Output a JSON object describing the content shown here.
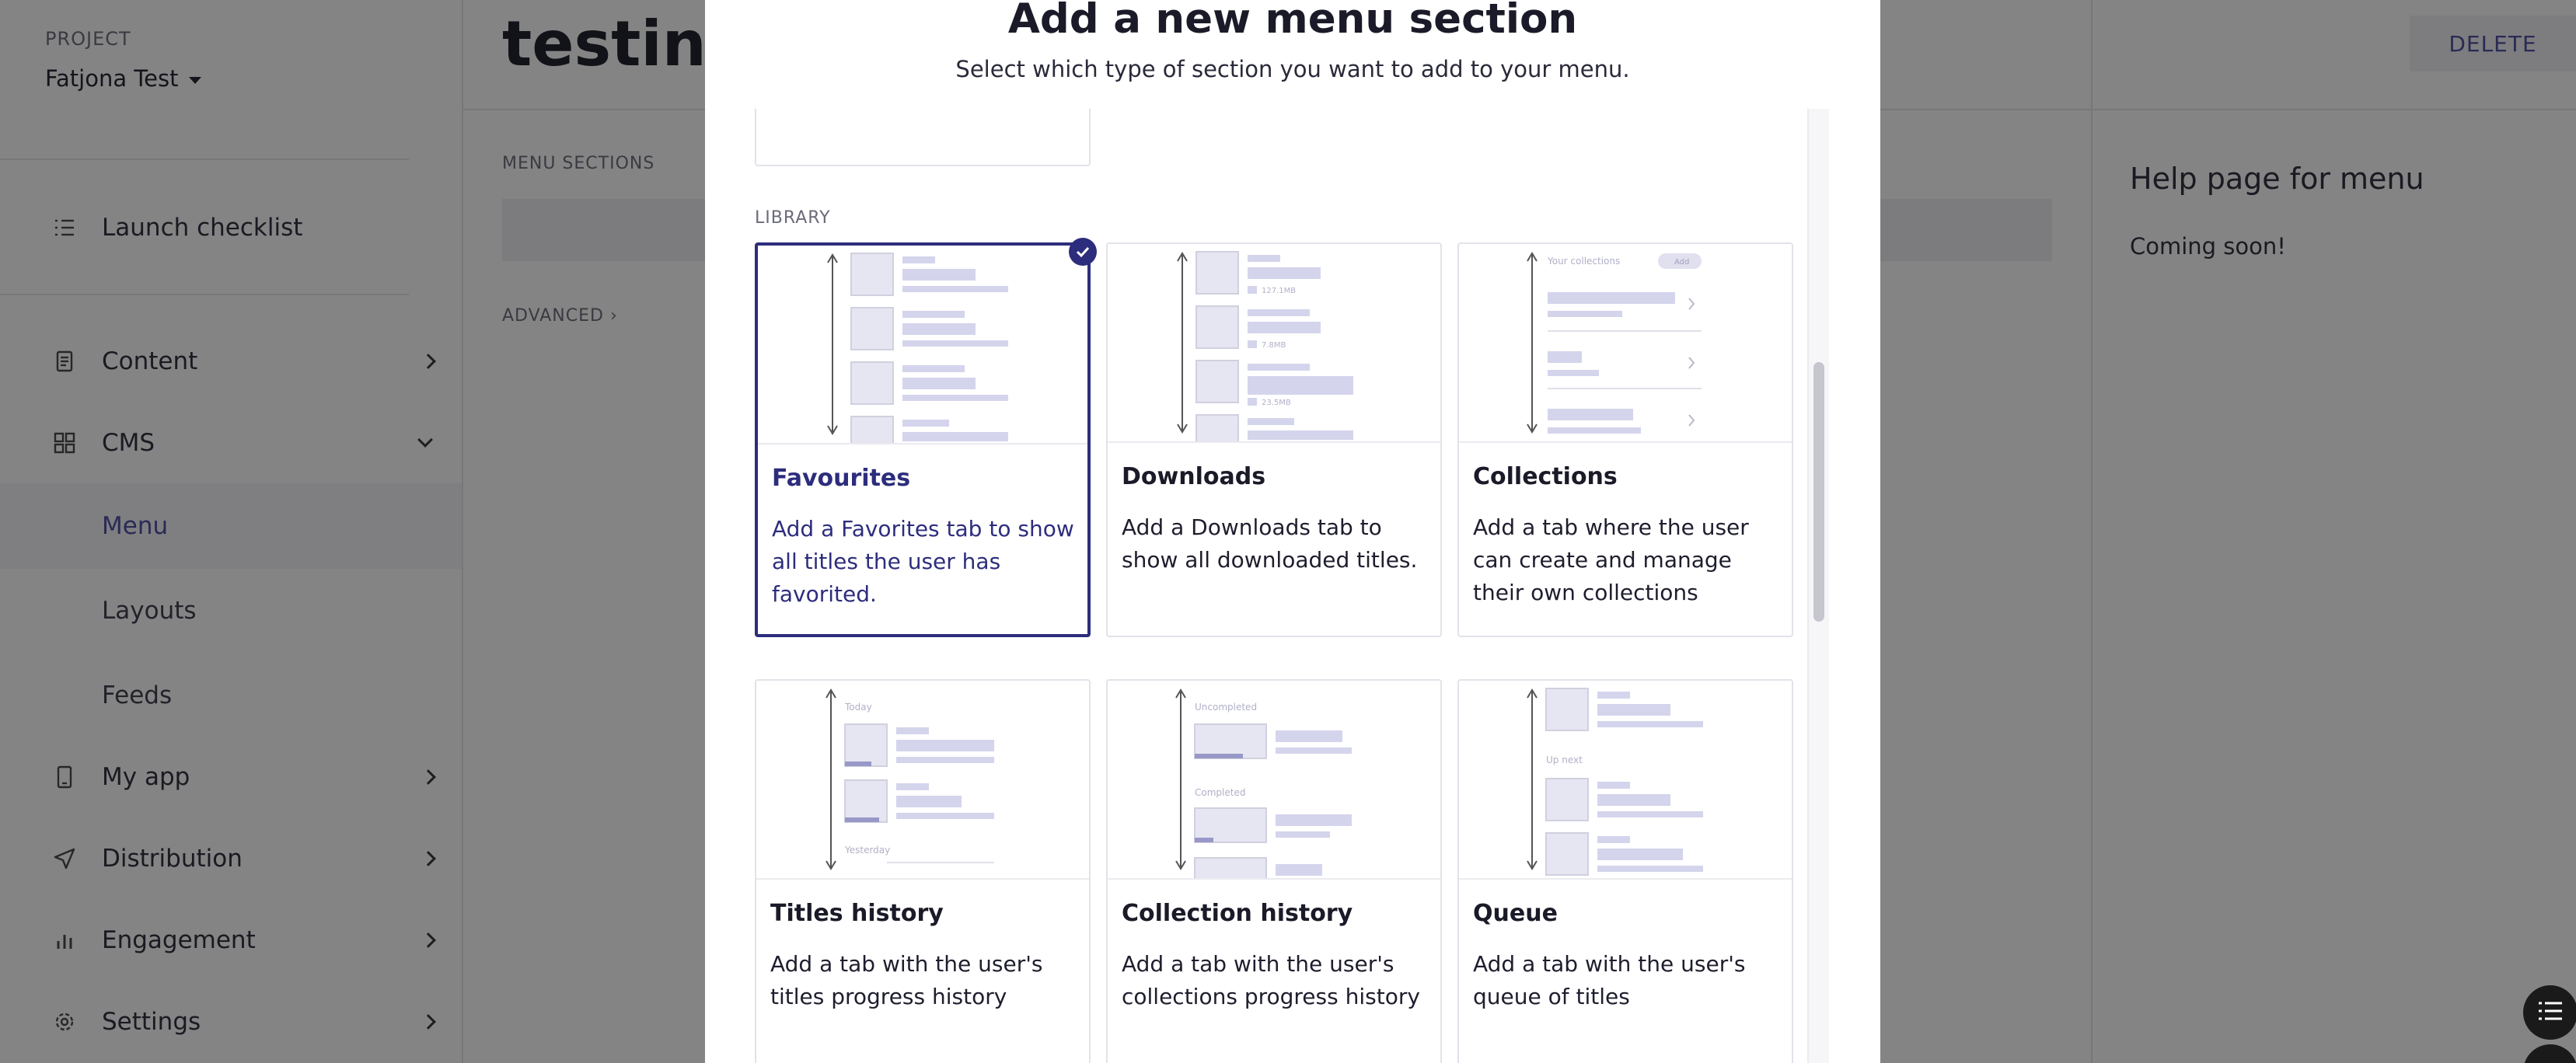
{
  "sidebar": {
    "project_label": "PROJECT",
    "project_name": "Fatjona Test",
    "items": [
      {
        "label": "Launch checklist",
        "icon": "checklist-icon"
      },
      {
        "label": "Content",
        "icon": "document-icon"
      },
      {
        "label": "CMS",
        "icon": "grid-icon"
      },
      {
        "label": "Menu"
      },
      {
        "label": "Layouts"
      },
      {
        "label": "Feeds"
      },
      {
        "label": "My app",
        "icon": "phone-icon"
      },
      {
        "label": "Distribution",
        "icon": "send-icon"
      },
      {
        "label": "Engagement",
        "icon": "bar-chart-icon"
      },
      {
        "label": "Settings",
        "icon": "gear-icon"
      }
    ]
  },
  "main": {
    "title": "testing",
    "menu_sections_label": "MENU SECTIONS",
    "advanced_label": "ADVANCED"
  },
  "help": {
    "delete_label": "DELETE",
    "title": "Help page for menu",
    "text": "Coming soon!"
  },
  "modal": {
    "title": "Add a new menu section",
    "subtitle": "Select which type of section you want to add to your menu.",
    "library_label": "LIBRARY",
    "cards": [
      {
        "title": "Favourites",
        "description": "Add a Favorites tab to show all titles the user has favorited.",
        "selected": true
      },
      {
        "title": "Downloads",
        "description": "Add a Downloads tab to show all downloaded titles.",
        "selected": false,
        "illus_labels": [
          "127.1MB",
          "7.8MB",
          "23.5MB"
        ]
      },
      {
        "title": "Collections",
        "description": "Add a tab where the user can create and manage their own collections",
        "selected": false,
        "illus_labels": [
          "Your collections",
          "Add"
        ]
      },
      {
        "title": "Titles history",
        "description": "Add a tab with the user's titles progress history",
        "selected": false,
        "illus_labels": [
          "Today",
          "Yesterday"
        ]
      },
      {
        "title": "Collection history",
        "description": "Add a tab with the user's collections progress history",
        "selected": false,
        "illus_labels": [
          "Uncompleted",
          "Completed"
        ]
      },
      {
        "title": "Queue",
        "description": "Add a tab with the user's queue of titles",
        "selected": false,
        "illus_labels": [
          "Up next"
        ]
      }
    ]
  },
  "colors": {
    "accent": "#2d2d7d",
    "overlay": "rgba(10,10,10,0.5)"
  }
}
